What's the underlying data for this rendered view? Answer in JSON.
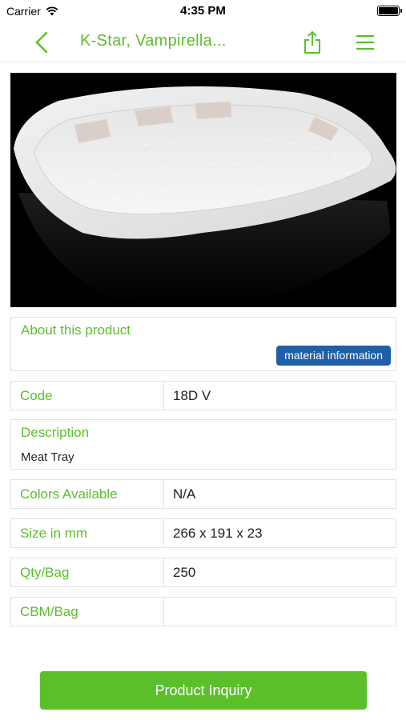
{
  "statusbar": {
    "carrier": "Carrier",
    "time": "4:35 PM"
  },
  "navbar": {
    "title": "K-Star, Vampirella..."
  },
  "about": {
    "title": "About this product",
    "material_button": "material information"
  },
  "rows": {
    "code": {
      "label": "Code",
      "value": "18D V"
    },
    "colors": {
      "label": "Colors Available",
      "value": "N/A"
    },
    "size": {
      "label": "Size in mm",
      "value": "266 x 191 x 23"
    },
    "qty": {
      "label": "Qty/Bag",
      "value": "250"
    },
    "cbm": {
      "label": "CBM/Bag",
      "value": ""
    }
  },
  "description": {
    "title": "Description",
    "text": "Meat Tray"
  },
  "inquiry_button": "Product Inquiry",
  "colors": {
    "accent": "#5bbf2a",
    "button_blue": "#1f5fa8"
  },
  "icons": [
    "wifi-icon",
    "battery-icon",
    "back-chevron-icon",
    "share-icon",
    "menu-icon"
  ]
}
